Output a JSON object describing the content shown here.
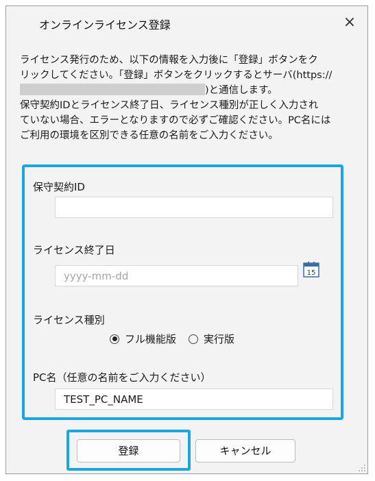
{
  "dialog": {
    "title": "オンラインライセンス登録",
    "close_glyph": "×"
  },
  "description": {
    "line1": "ライセンス発行のため、以下の情報を入力後に「登録」ボタンをク",
    "line2": "リックしてください。「登録」ボタンをクリックするとサーバ(https://",
    "line3_suffix": ")と通信します。",
    "line4": "保守契約IDとライセンス終了日、ライセンス種別が正しく入力され",
    "line5": "ていない場合、エラーとなりますので必ずご確認ください。PC名には",
    "line6": "ご利用の環境を区別できる任意の名前をご入力ください。"
  },
  "form": {
    "contract_id": {
      "label": "保守契約ID",
      "value": ""
    },
    "end_date": {
      "label": "ライセンス終了日",
      "placeholder": "yyyy-mm-dd",
      "value": "",
      "calendar_day": "15"
    },
    "license_type": {
      "label": "ライセンス種別",
      "options": [
        {
          "label": "フル機能版",
          "selected": true
        },
        {
          "label": "実行版",
          "selected": false
        }
      ]
    },
    "pc_name": {
      "label": "PC名（任意の名前をご入力ください）",
      "value": "TEST_PC_NAME"
    }
  },
  "buttons": {
    "register": "登録",
    "cancel": "キャンセル"
  },
  "colors": {
    "highlight": "#18a8df",
    "dialog_bg": "#f3f3f3"
  }
}
